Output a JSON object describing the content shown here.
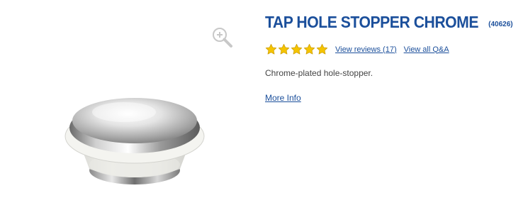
{
  "product": {
    "title": "TAP HOLE STOPPER CHROME",
    "code": "(40626)",
    "description": "Chrome-plated hole-stopper.",
    "more_info_label": "More Info",
    "image_icon": "chrome-hole-stopper-image"
  },
  "rating": {
    "stars": 5,
    "max_stars": 5,
    "reviews_label": "View reviews (17)",
    "qa_label": "View all Q&A",
    "star_color": "#f5c400"
  },
  "zoom": {
    "icon": "zoom-in-icon"
  },
  "colors": {
    "brand": "#1b4f9b",
    "text": "#444444"
  }
}
